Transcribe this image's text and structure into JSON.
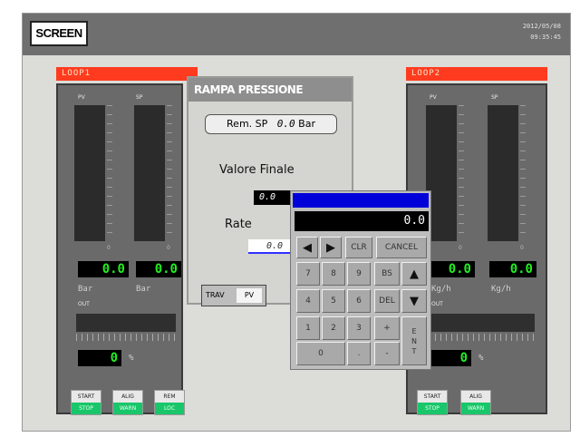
{
  "header": {
    "logo": "SCREEN",
    "date": "2012/05/08",
    "time": "09:35:45"
  },
  "loop1": {
    "tag": "LOOP1",
    "pv_label": "PV",
    "sp_label": "SP",
    "pv_zero": "0",
    "sp_zero": "0",
    "pv_value": "0.0",
    "sp_value": "0.0",
    "pv_unit": "Bar",
    "sp_unit": "Bar",
    "out_label": "OUT",
    "out_value": "0",
    "out_unit": "%",
    "buttons": [
      {
        "top": "START",
        "bottom": "STOP"
      },
      {
        "top": "ALIG",
        "bottom": "WARN"
      },
      {
        "top": "REM",
        "bottom": "LOC"
      }
    ]
  },
  "loop2": {
    "tag": "LOOP2",
    "pv_label": "PV",
    "sp_label": "SP",
    "pv_zero": "0",
    "sp_zero": "0",
    "pv_value": "0.0",
    "sp_value": "0.0",
    "pv_unit": "Kg/h",
    "sp_unit": "Kg/h",
    "out_label": "OUT",
    "out_value": "0",
    "out_unit": "%",
    "buttons": [
      {
        "top": "START",
        "bottom": "STOP"
      },
      {
        "top": "ALIG",
        "bottom": "WARN"
      }
    ]
  },
  "ramp": {
    "title": "RAMPA PRESSIONE",
    "rem_sp_label": "Rem. SP",
    "rem_sp_value": "0.0",
    "rem_sp_unit": "Bar",
    "valore_finale_label": "Valore Finale",
    "valore_finale_value": "0.0",
    "rate_label": "Rate",
    "rate_value": "0.0",
    "trav_label": "TRAV",
    "trav_value": "PV"
  },
  "keypad": {
    "display": "0.0",
    "keys": {
      "left": "◀",
      "right": "▶",
      "clr": "CLR",
      "cancel": "CANCEL",
      "k7": "7",
      "k8": "8",
      "k9": "9",
      "bs": "BS",
      "up": "▲",
      "k4": "4",
      "k5": "5",
      "k6": "6",
      "del": "DEL",
      "down": "▼",
      "k1": "1",
      "k2": "2",
      "k3": "3",
      "plus": "+",
      "ent": "E N T",
      "k0": "0",
      "dot": ".",
      "minus": "-"
    }
  }
}
